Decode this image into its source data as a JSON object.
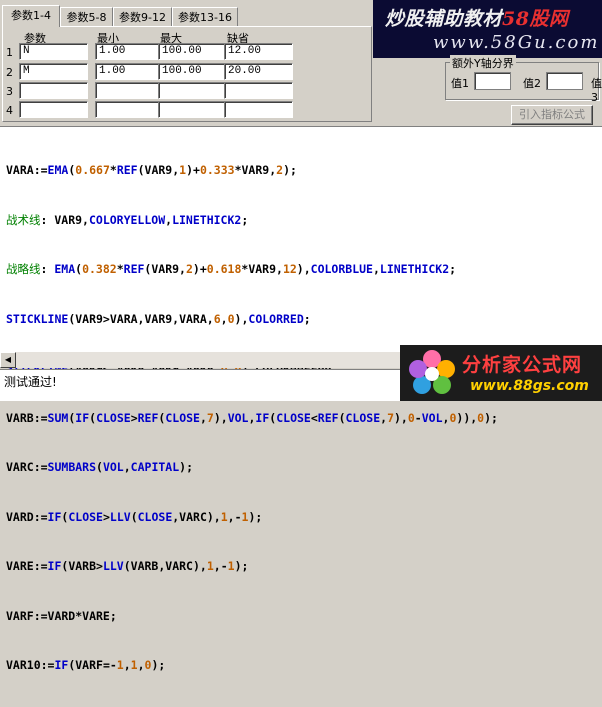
{
  "tabs": [
    "参数1-4",
    "参数5-8",
    "参数9-12",
    "参数13-16"
  ],
  "param_table": {
    "headers": [
      "参数",
      "最小",
      "最大",
      "缺省"
    ],
    "rows": [
      {
        "num": "1",
        "name": "N",
        "min": "1.00",
        "max": "100.00",
        "default": "12.00"
      },
      {
        "num": "2",
        "name": "M",
        "min": "1.00",
        "max": "100.00",
        "default": "20.00"
      },
      {
        "num": "3",
        "name": "",
        "min": "",
        "max": "",
        "default": ""
      },
      {
        "num": "4",
        "name": "",
        "min": "",
        "max": "",
        "default": ""
      }
    ]
  },
  "banner": {
    "title_white": "炒股辅助教材",
    "title_red": "58股网",
    "url": "www.58Gu.com"
  },
  "axis_group": {
    "title": "额外Y轴分界",
    "value1_label": "值1",
    "value2_label": "值2",
    "value3_label": "值3"
  },
  "import_button": "引入指标公式",
  "code_lines": [
    "VARA:=EMA(0.667*REF(VAR9,1)+0.333*VAR9,2);",
    "战术线: VAR9,COLORYELLOW,LINETHICK2;",
    "战略线: EMA(0.382*REF(VAR9,2)+0.618*VAR9,12),COLORBLUE,LINETHICK2;",
    "STICKLINE(VAR9>VARA,VAR9,VARA,6,0),COLORRED;",
    "STICKLINE(VAR9<=VARA,VAR9,VARA,6,0),COLOR00FF00;",
    "VARB:=SUM(IF(CLOSE>REF(CLOSE,7),VOL,IF(CLOSE<REF(CLOSE,7),0-VOL,0)),0);",
    "VARC:=SUMBARS(VOL,CAPITAL);",
    "VARD:=IF(CLOSE>LLV(CLOSE,VARC),1,-1);",
    "VARE:=IF(VARB>LLV(VARB,VARC),1,-1);",
    "VARF:=VARD*VARE;",
    "VAR10:=IF(VARF=-1,1,0);"
  ],
  "status_text": "测试通过!",
  "logo": {
    "title": "分析家公式网",
    "url": "www.88gs.com"
  }
}
